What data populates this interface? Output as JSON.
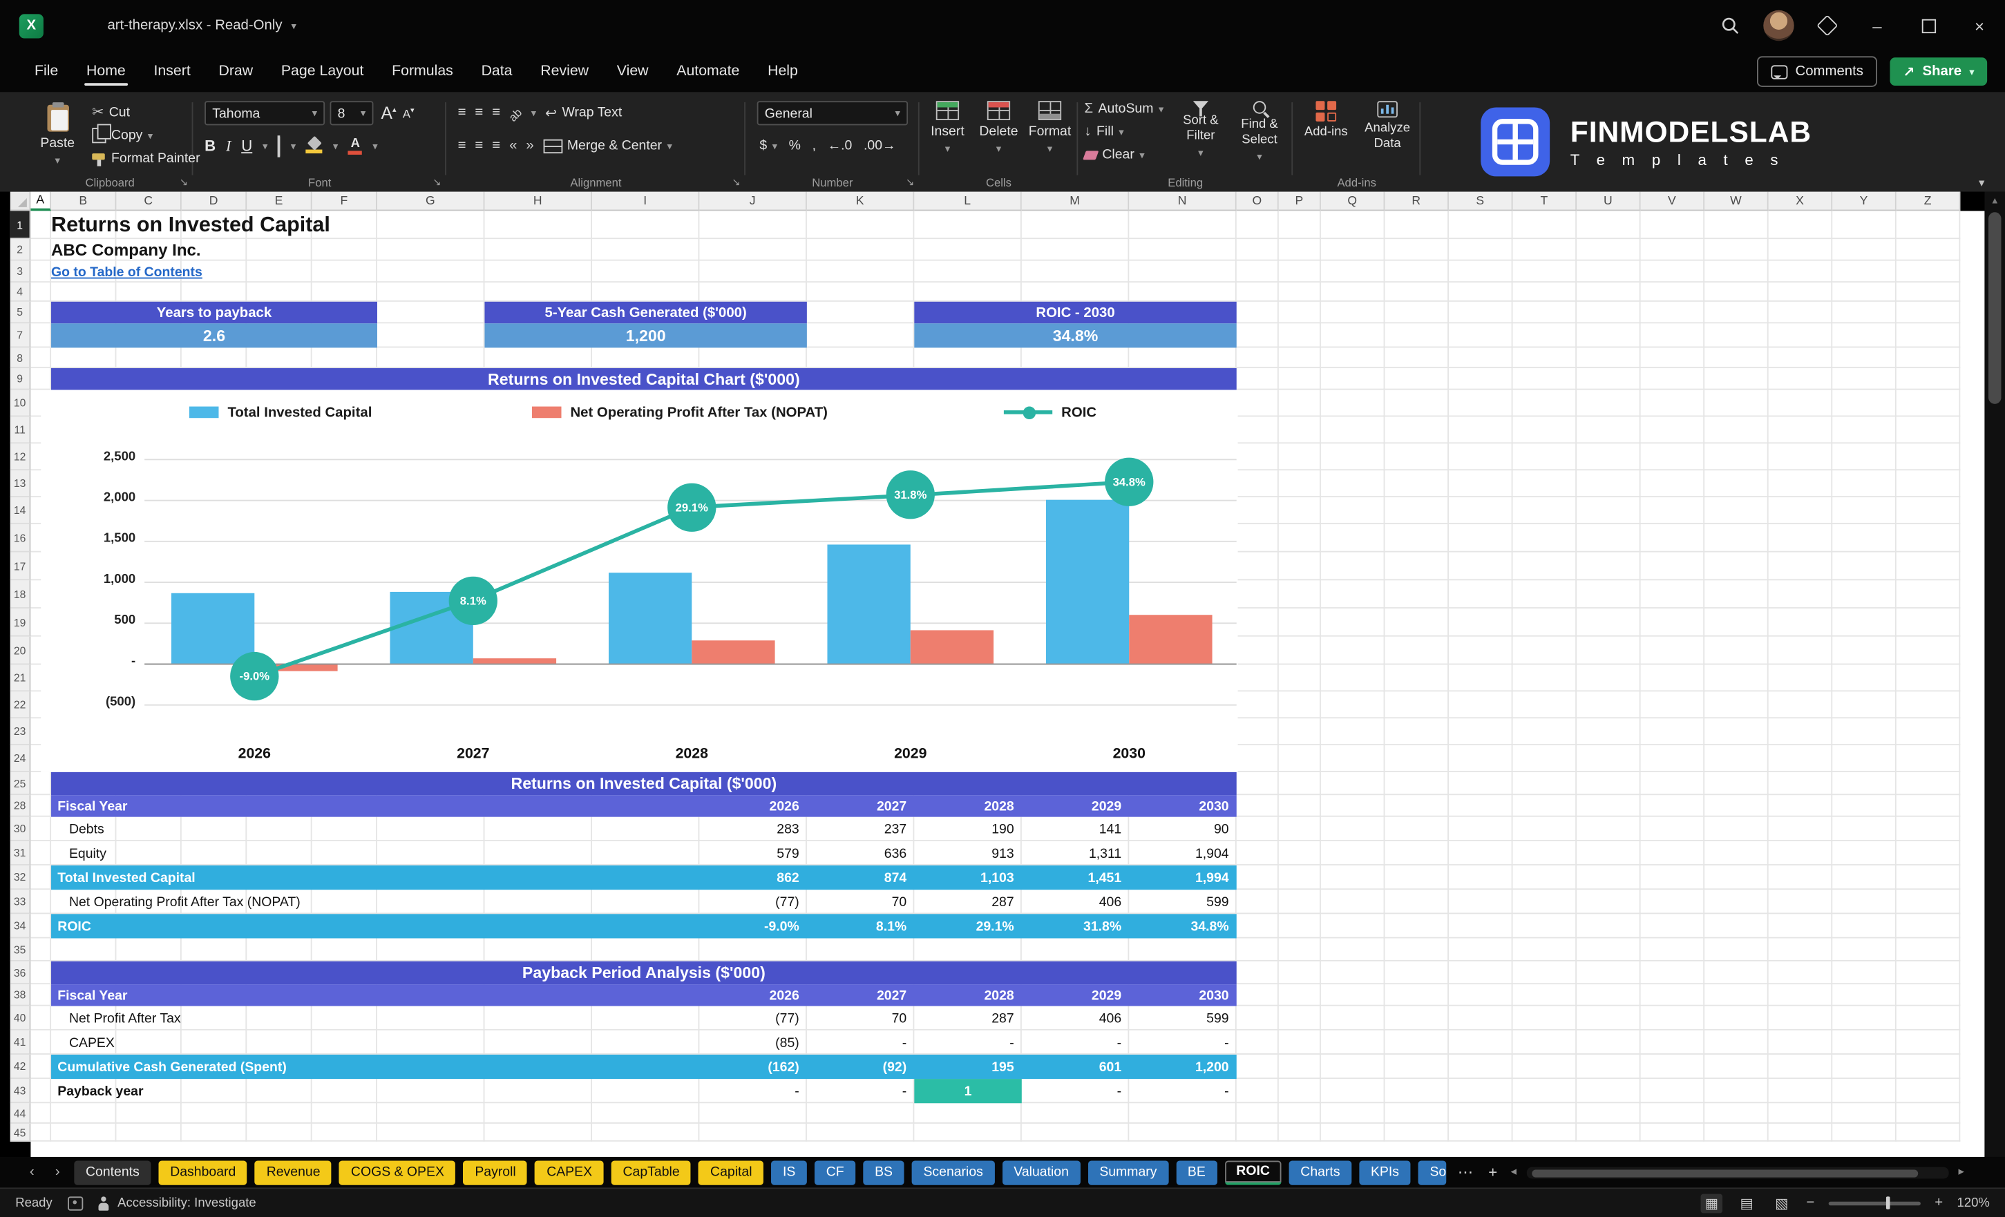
{
  "titlebar": {
    "title": "art-therapy.xlsx  -  Read-Only"
  },
  "menu": {
    "items": [
      "File",
      "Home",
      "Insert",
      "Draw",
      "Page Layout",
      "Formulas",
      "Data",
      "Review",
      "View",
      "Automate",
      "Help"
    ],
    "active": "Home",
    "comments": "Comments",
    "share": "Share"
  },
  "ribbon": {
    "clipboard": {
      "label": "Clipboard",
      "paste": "Paste",
      "cut": "Cut",
      "copy": "Copy",
      "format_painter": "Format Painter"
    },
    "font": {
      "label": "Font",
      "font_name": "Tahoma",
      "font_size": "8"
    },
    "alignment": {
      "label": "Alignment",
      "wrap_text": "Wrap Text",
      "merge_center": "Merge & Center"
    },
    "number": {
      "label": "Number",
      "format": "General"
    },
    "cells": {
      "label": "Cells",
      "insert": "Insert",
      "delete": "Delete",
      "format": "Format"
    },
    "editing": {
      "label": "Editing",
      "autosum": "AutoSum",
      "fill": "Fill",
      "clear": "Clear",
      "sort_filter": "Sort & Filter",
      "find_select": "Find & Select"
    },
    "addins": {
      "label": "Add-ins",
      "addins": "Add-ins",
      "analyze": "Analyze Data"
    }
  },
  "logo": {
    "brand": "FINMODELSLAB",
    "sub": "T e m p l a t e s"
  },
  "sheet": {
    "columns": [
      {
        "l": "A",
        "w": 16
      },
      {
        "l": "B",
        "w": 51
      },
      {
        "l": "C",
        "w": 51
      },
      {
        "l": "D",
        "w": 51
      },
      {
        "l": "E",
        "w": 51
      },
      {
        "l": "F",
        "w": 51
      },
      {
        "l": "G",
        "w": 84
      },
      {
        "l": "H",
        "w": 84
      },
      {
        "l": "I",
        "w": 84
      },
      {
        "l": "J",
        "w": 84
      },
      {
        "l": "K",
        "w": 84
      },
      {
        "l": "L",
        "w": 84
      },
      {
        "l": "M",
        "w": 84
      },
      {
        "l": "N",
        "w": 84
      },
      {
        "l": "O",
        "w": 33
      },
      {
        "l": "P",
        "w": 33
      },
      {
        "l": "Q",
        "w": 50
      },
      {
        "l": "R",
        "w": 50
      },
      {
        "l": "S",
        "w": 50
      },
      {
        "l": "T",
        "w": 50
      },
      {
        "l": "U",
        "w": 50
      },
      {
        "l": "V",
        "w": 50
      },
      {
        "l": "W",
        "w": 50
      },
      {
        "l": "X",
        "w": 50
      },
      {
        "l": "Y",
        "w": 50
      },
      {
        "l": "Z",
        "w": 50
      }
    ],
    "rows": [
      {
        "n": "1",
        "h": 22
      },
      {
        "n": "2",
        "h": 17
      },
      {
        "n": "3",
        "h": 17
      },
      {
        "n": "4",
        "h": 15
      },
      {
        "n": "5",
        "h": 17
      },
      {
        "n": "7",
        "h": 19
      },
      {
        "n": "8",
        "h": 16
      },
      {
        "n": "9",
        "h": 17
      },
      {
        "n": "10",
        "h": 21
      },
      {
        "n": "11",
        "h": 21
      },
      {
        "n": "12",
        "h": 21
      },
      {
        "n": "13",
        "h": 21
      },
      {
        "n": "14",
        "h": 21
      },
      {
        "n": "16",
        "h": 22
      },
      {
        "n": "17",
        "h": 22
      },
      {
        "n": "18",
        "h": 22
      },
      {
        "n": "19",
        "h": 22
      },
      {
        "n": "20",
        "h": 22
      },
      {
        "n": "21",
        "h": 21
      },
      {
        "n": "22",
        "h": 21
      },
      {
        "n": "23",
        "h": 21
      },
      {
        "n": "24",
        "h": 21
      },
      {
        "n": "25",
        "h": 18
      },
      {
        "n": "28",
        "h": 17
      },
      {
        "n": "30",
        "h": 19
      },
      {
        "n": "31",
        "h": 19
      },
      {
        "n": "32",
        "h": 19
      },
      {
        "n": "33",
        "h": 19
      },
      {
        "n": "34",
        "h": 19
      },
      {
        "n": "35",
        "h": 18
      },
      {
        "n": "36",
        "h": 18
      },
      {
        "n": "38",
        "h": 17
      },
      {
        "n": "40",
        "h": 19
      },
      {
        "n": "41",
        "h": 19
      },
      {
        "n": "42",
        "h": 19
      },
      {
        "n": "43",
        "h": 19
      },
      {
        "n": "44",
        "h": 16
      },
      {
        "n": "45",
        "h": 14
      }
    ],
    "title": "Returns on Invested Capital",
    "subtitle": "ABC Company Inc.",
    "link": "Go to Table of Contents",
    "kpis": [
      {
        "label": "Years to payback",
        "value": "2.6"
      },
      {
        "label": "5-Year Cash Generated ($'000)",
        "value": "1,200"
      },
      {
        "label": "ROIC - 2030",
        "value": "34.8%"
      }
    ]
  },
  "chart_data": {
    "type": "combo",
    "title": "Returns on Invested Capital Chart ($'000)",
    "categories": [
      "2026",
      "2027",
      "2028",
      "2029",
      "2030"
    ],
    "series": [
      {
        "name": "Total Invested Capital",
        "type": "bar",
        "color": "#4db8e8",
        "values": [
          862,
          874,
          1103,
          1451,
          1994
        ]
      },
      {
        "name": "Net Operating Profit After Tax (NOPAT)",
        "type": "bar",
        "color": "#ee7e6e",
        "values": [
          -77,
          70,
          287,
          406,
          599
        ]
      },
      {
        "name": "ROIC",
        "type": "line",
        "axis": "secondary",
        "color": "#2ab3a3",
        "values_pct": [
          -9.0,
          8.1,
          29.1,
          31.8,
          34.8
        ],
        "labels": [
          "-9.0%",
          "8.1%",
          "29.1%",
          "31.8%",
          "34.8%"
        ]
      }
    ],
    "y_ticks": [
      "2,500",
      "2,000",
      "1,500",
      "1,000",
      "500",
      "-",
      "(500)"
    ],
    "ylim": [
      -500,
      2500
    ],
    "legend_position": "top",
    "grid": true
  },
  "table1": {
    "banner": "Returns on Invested Capital ($'000)",
    "header": {
      "label": "Fiscal Year",
      "years": [
        "2026",
        "2027",
        "2028",
        "2029",
        "2030"
      ]
    },
    "rows": [
      {
        "label": "Debts",
        "style": "plain",
        "values": [
          "283",
          "237",
          "190",
          "141",
          "90"
        ]
      },
      {
        "label": "Equity",
        "style": "plain",
        "values": [
          "579",
          "636",
          "913",
          "1,311",
          "1,904"
        ]
      },
      {
        "label": "Total Invested Capital",
        "style": "total",
        "values": [
          "862",
          "874",
          "1,103",
          "1,451",
          "1,994"
        ]
      },
      {
        "label": "Net Operating Profit After Tax (NOPAT)",
        "style": "plain",
        "values": [
          "(77)",
          "70",
          "287",
          "406",
          "599"
        ]
      },
      {
        "label": "ROIC",
        "style": "total",
        "values": [
          "-9.0%",
          "8.1%",
          "29.1%",
          "31.8%",
          "34.8%"
        ]
      }
    ]
  },
  "table2": {
    "banner": "Payback Period Analysis ($'000)",
    "header": {
      "label": "Fiscal Year",
      "years": [
        "2026",
        "2027",
        "2028",
        "2029",
        "2030"
      ]
    },
    "rows": [
      {
        "label": "Net Profit After Tax",
        "style": "plain",
        "values": [
          "(77)",
          "70",
          "287",
          "406",
          "599"
        ]
      },
      {
        "label": "CAPEX",
        "style": "plain",
        "values": [
          "(85)",
          "-",
          "-",
          "-",
          "-"
        ]
      },
      {
        "label": "Cumulative Cash Generated (Spent)",
        "style": "total",
        "values": [
          "(162)",
          "(92)",
          "195",
          "601",
          "1,200"
        ]
      },
      {
        "label": "Payback year",
        "style": "payback",
        "values": [
          "-",
          "-",
          "1",
          "-",
          "-"
        ],
        "highlight_index": 2
      }
    ]
  },
  "tabs": {
    "items": [
      {
        "label": "Contents",
        "type": "dark"
      },
      {
        "label": "Dashboard",
        "type": "yellow"
      },
      {
        "label": "Revenue",
        "type": "yellow"
      },
      {
        "label": "COGS & OPEX",
        "type": "yellow"
      },
      {
        "label": "Payroll",
        "type": "yellow"
      },
      {
        "label": "CAPEX",
        "type": "yellow"
      },
      {
        "label": "CapTable",
        "type": "yellow"
      },
      {
        "label": "Capital",
        "type": "yellow"
      },
      {
        "label": "IS",
        "type": "blue"
      },
      {
        "label": "CF",
        "type": "blue"
      },
      {
        "label": "BS",
        "type": "blue"
      },
      {
        "label": "Scenarios",
        "type": "blue"
      },
      {
        "label": "Valuation",
        "type": "blue"
      },
      {
        "label": "Summary",
        "type": "blue"
      },
      {
        "label": "BE",
        "type": "blue"
      },
      {
        "label": "ROIC",
        "type": "active"
      },
      {
        "label": "Charts",
        "type": "blue"
      },
      {
        "label": "KPIs",
        "type": "blue"
      },
      {
        "label": "So",
        "type": "blue clip"
      }
    ]
  },
  "statusbar": {
    "ready": "Ready",
    "accessibility": "Accessibility: Investigate",
    "zoom": "120%"
  }
}
